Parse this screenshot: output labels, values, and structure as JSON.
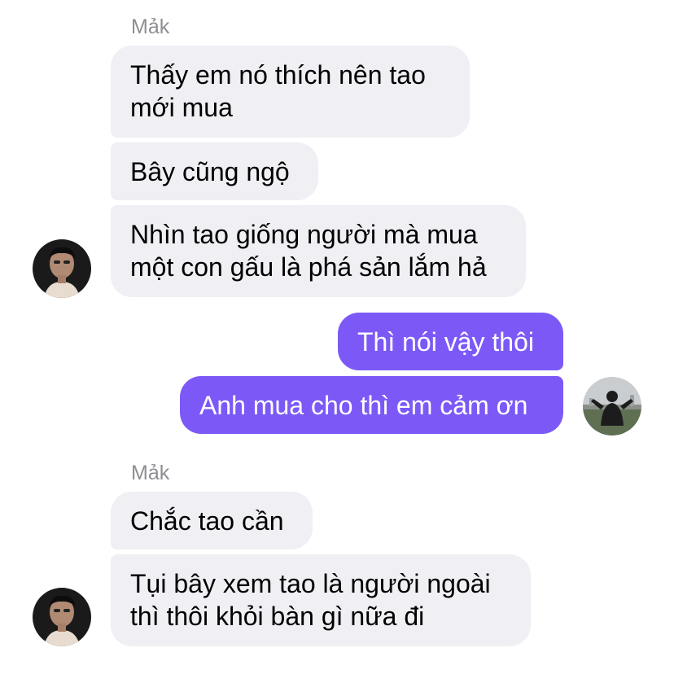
{
  "chat": {
    "group1": {
      "sender": "Mảk",
      "messages": [
        [
          "Thấy em nó thích nên tao",
          "mới mua"
        ],
        [
          "Bây cũng ngộ"
        ],
        [
          "Nhìn tao giống người mà mua",
          "một con gấu là phá sản lắm hả"
        ]
      ]
    },
    "outgoing": {
      "messages": [
        "Thì nói vậy thôi",
        "Anh mua cho thì em cảm ơn"
      ]
    },
    "group2": {
      "sender": "Mảk",
      "messages": [
        [
          "Chắc tao cần"
        ],
        [
          "Tụi bây xem tao là người ngoài",
          "thì thôi khỏi bàn gì nữa đi"
        ]
      ]
    }
  },
  "colors": {
    "incoming_bubble": "#efeff4",
    "outgoing_bubble": "#7c59f7",
    "sender_name": "#8e8e93"
  },
  "icons": {
    "contact_avatar": "contact-avatar-icon",
    "self_avatar": "self-avatar-icon"
  }
}
